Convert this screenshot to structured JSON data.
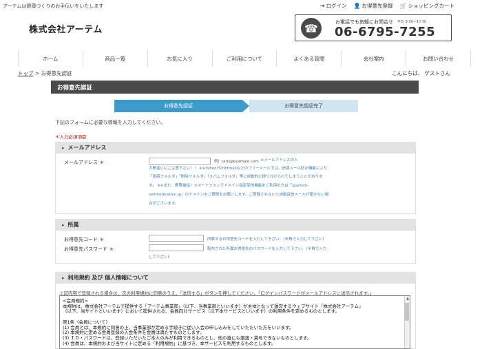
{
  "header": {
    "tagline": "アーテムは健康づくりのお手伝いをいたします",
    "links": [
      {
        "icon": "login-icon",
        "label": "ログイン"
      },
      {
        "icon": "user-icon",
        "label": "お得意先登録"
      },
      {
        "icon": "cart-icon",
        "label": "ショッピングカート"
      }
    ],
    "logo": "株式会社アーテム",
    "tel": {
      "label": "お電話でも気軽にお問合せ",
      "hours": "平日 9:00～17:30",
      "number": "06-6795-7255"
    }
  },
  "nav": [
    "ホーム",
    "商品一覧",
    "お気に入り",
    "ご利用について",
    "よくある質問",
    "会社案内",
    "お問い合わせ"
  ],
  "breadcrumb": {
    "home": "トップ",
    "separator": " > ",
    "current": "お得意先認証"
  },
  "greeting": "こんにちは、 ゲストさん",
  "page_title": "お得意先認証",
  "steps": {
    "step1": "お得意先認証",
    "step2": "お得意先認証完了"
  },
  "intro": "下記のフォームに必要な情報を入力してください。",
  "required_note": "＊入力必須項目",
  "mail_section": {
    "title": "メールアドレス",
    "label": "メールアドレス",
    "req": "＊",
    "example": "例）taro@example.com",
    "lines": [
      "　※メールアドレスの入",
      "力間違いにご注意下さい！！ ※※Yahoo!やHotmailなどのフリーメールでは、迷惑メール防止機能により",
      "「迷惑フォルダ」「削除フォルダ」「スパムフォルダ」等に自動的に振り分けられてしまうことがありま",
      "す。 ※※また、携帯電話・スマートフォンでドメイン指定受信機能をご利用の方は「@artem-",
      "selfmedication.jp」のドメインをご登録をお願いします。ご登録されないと自動返信メールが届かない場",
      "合がございます。"
    ]
  },
  "belong_section": {
    "title": "所属",
    "code_label": "お得意先コード",
    "code_note": "所属するお得意先コードを入力して下さい。（半角で入力して下さい）",
    "pass_label": "お得意先パスワード",
    "pass_note": "配布された所属お得意先のパスワードを入力して下さい。（半角で入力",
    "pass_note2": "して下さい）",
    "req": "＊"
  },
  "terms_section": {
    "title": "利用規約 及び 個人情報について",
    "note": "上記内容で登録される場合は、次の利用規約に同意のうえ、「送信する」ボタンを押してください。「ログインパスワードがメールアドレスに送信されます。」",
    "body": "<会員規約>\n本規約は、株式会社アーテムで提供する「アーテム事業部」（以下、当事業部といいます）が主体となって運営するウェブサイト「株式会社アーテム」\n（以下、当サイトといいます）において提供される、会員向けサービス（以下本サービスといいます）の利用条件を定めるものとします。\n\n第1条（会員について）\n(1) 会員とは、本規約に同意の上、当事業部が定める手続きに従い入会の申し込みをしていただいた方をいいます。\n(2) 本規約に定める会員登録の入会条件を会員は満たすものとします。\n(3) ＩＤ・パスワードは、登録いただいたご本人のみが利用できるものとし、他の誰にも譲渡・貸与できないものとします。\n(4) 会員は、本規約および当サイトに定める「利用規約」に基づき、本サービスを利用するものとします。"
  }
}
